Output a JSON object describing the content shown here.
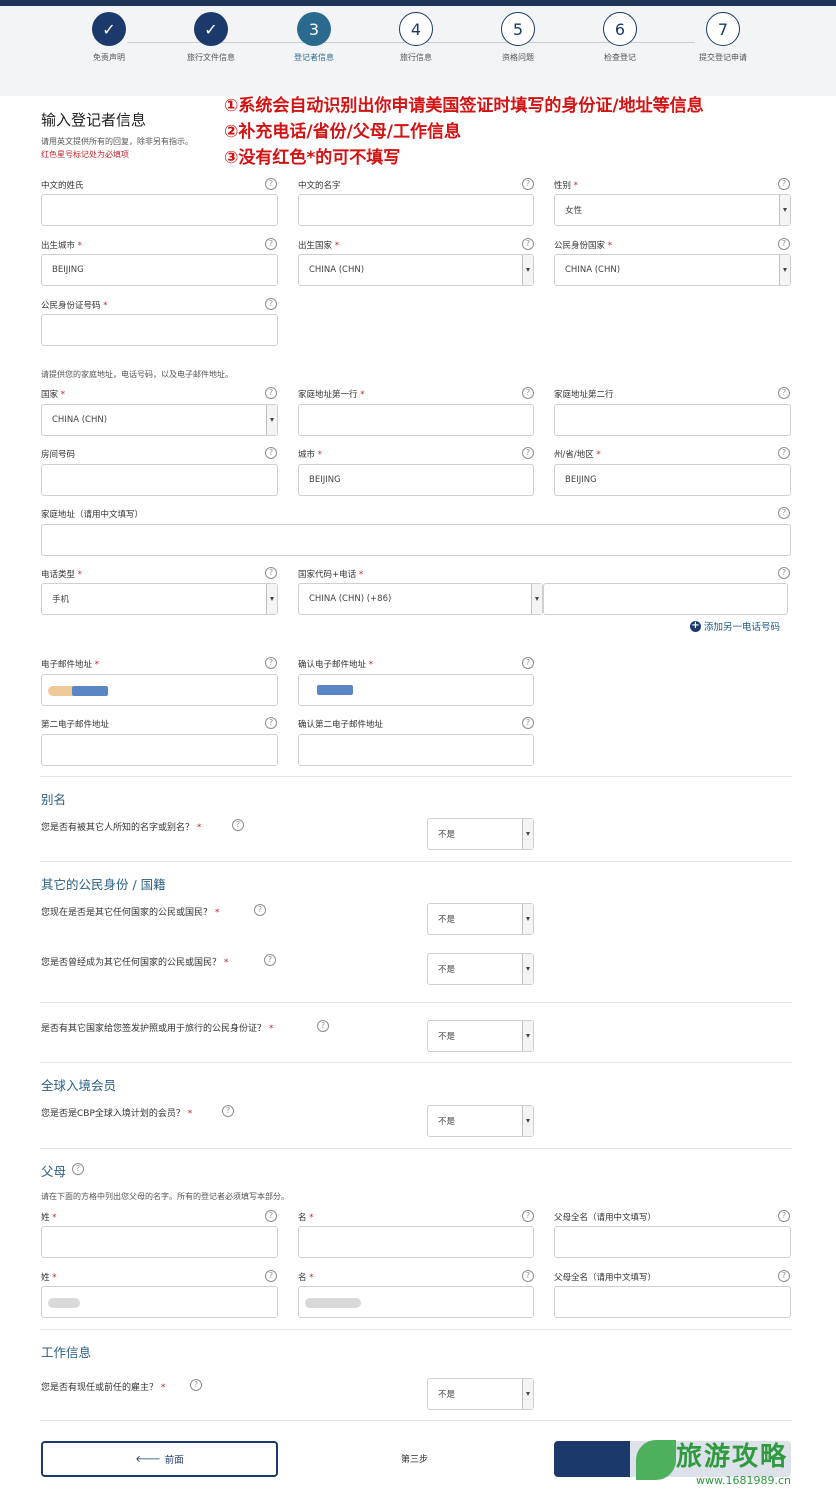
{
  "steps": [
    {
      "num": "✓",
      "label": "免责声明",
      "state": "done"
    },
    {
      "num": "✓",
      "label": "旅行文件信息",
      "state": "done"
    },
    {
      "num": "3",
      "label": "登记者信息",
      "state": "current"
    },
    {
      "num": "4",
      "label": "旅行信息",
      "state": "todo"
    },
    {
      "num": "5",
      "label": "资格问题",
      "state": "todo"
    },
    {
      "num": "6",
      "label": "检查登记",
      "state": "todo"
    },
    {
      "num": "7",
      "label": "提交登记申请",
      "state": "todo"
    }
  ],
  "header": {
    "title": "输入登记者信息",
    "subtitle": "请用英文提供所有的回复，除非另有指示。",
    "required_note": "红色星号标记处为必填项"
  },
  "annotations": [
    "①系统会自动识别出你申请美国签证时填写的身份证/地址等信息",
    "②补充电话/省份/父母/工作信息",
    "③没有红色*的可不填写"
  ],
  "fields": {
    "cn_surname": {
      "label": "中文的姓氏",
      "value": ""
    },
    "cn_given": {
      "label": "中文的名字",
      "value": ""
    },
    "gender": {
      "label": "性别",
      "value": "女性"
    },
    "birth_city": {
      "label": "出生城市",
      "value": "BEIJING"
    },
    "birth_country": {
      "label": "出生国家",
      "value": "CHINA (CHN)"
    },
    "citizenship": {
      "label": "公民身份国家",
      "value": "CHINA (CHN)"
    },
    "national_id": {
      "label": "公民身份证号码",
      "value": ""
    },
    "address_note": "请提供您的家庭地址，电话号码，以及电子邮件地址。",
    "country": {
      "label": "国家",
      "value": "CHINA (CHN)"
    },
    "addr1": {
      "label": "家庭地址第一行",
      "value": ""
    },
    "addr2": {
      "label": "家庭地址第二行",
      "value": ""
    },
    "room": {
      "label": "房间号码",
      "value": ""
    },
    "city": {
      "label": "城市",
      "value": "BEIJING"
    },
    "state": {
      "label": "州/省/地区",
      "value": "BEIJING"
    },
    "addr_cn": {
      "label": "家庭地址（请用中文填写）",
      "value": ""
    },
    "phone_type": {
      "label": "电话类型",
      "value": "手机"
    },
    "phone": {
      "label": "国家代码+电话",
      "code": "CHINA (CHN) (+86)"
    },
    "add_phone": "添加另一电话号码",
    "email": {
      "label": "电子邮件地址"
    },
    "email_confirm": {
      "label": "确认电子邮件地址"
    },
    "email2": {
      "label": "第二电子邮件地址"
    },
    "email2_confirm": {
      "label": "确认第二电子邮件地址"
    }
  },
  "sections": {
    "alias": {
      "title": "别名",
      "q1": "您是否有被其它人所知的名字或别名？",
      "a1": "不是"
    },
    "other_citizen": {
      "title": "其它的公民身份 / 国籍",
      "q1": "您现在是否是其它任何国家的公民或国民？",
      "a1": "不是",
      "q2": "您是否曾经成为其它任何国家的公民或国民？",
      "a2": "不是",
      "q3": "是否有其它国家给您签发护照或用于旅行的公民身份证？",
      "a3": "不是"
    },
    "global_entry": {
      "title": "全球入境会员",
      "q1": "您是否是CBP全球入境计划的会员？",
      "a1": "不是"
    },
    "parents": {
      "title": "父母",
      "note": "请在下面的方格中列出您父母的名字。所有的登记者必须填写本部分。",
      "surname": "姓",
      "given": "名",
      "fullname_cn": "父母全名（请用中文填写）"
    },
    "work": {
      "title": "工作信息",
      "q1": "您是否有现任或前任的雇主？",
      "a1": "不是"
    }
  },
  "footer": {
    "prev": "前面",
    "step": "第三步"
  },
  "watermark": {
    "text": "旅游攻略",
    "url": "www.1681989.cn"
  },
  "colors": {
    "navy": "#1b3a6b",
    "current": "#2b6a8f",
    "required": "#c0262d",
    "annotation": "#d11313",
    "section": "#2b5f86"
  }
}
